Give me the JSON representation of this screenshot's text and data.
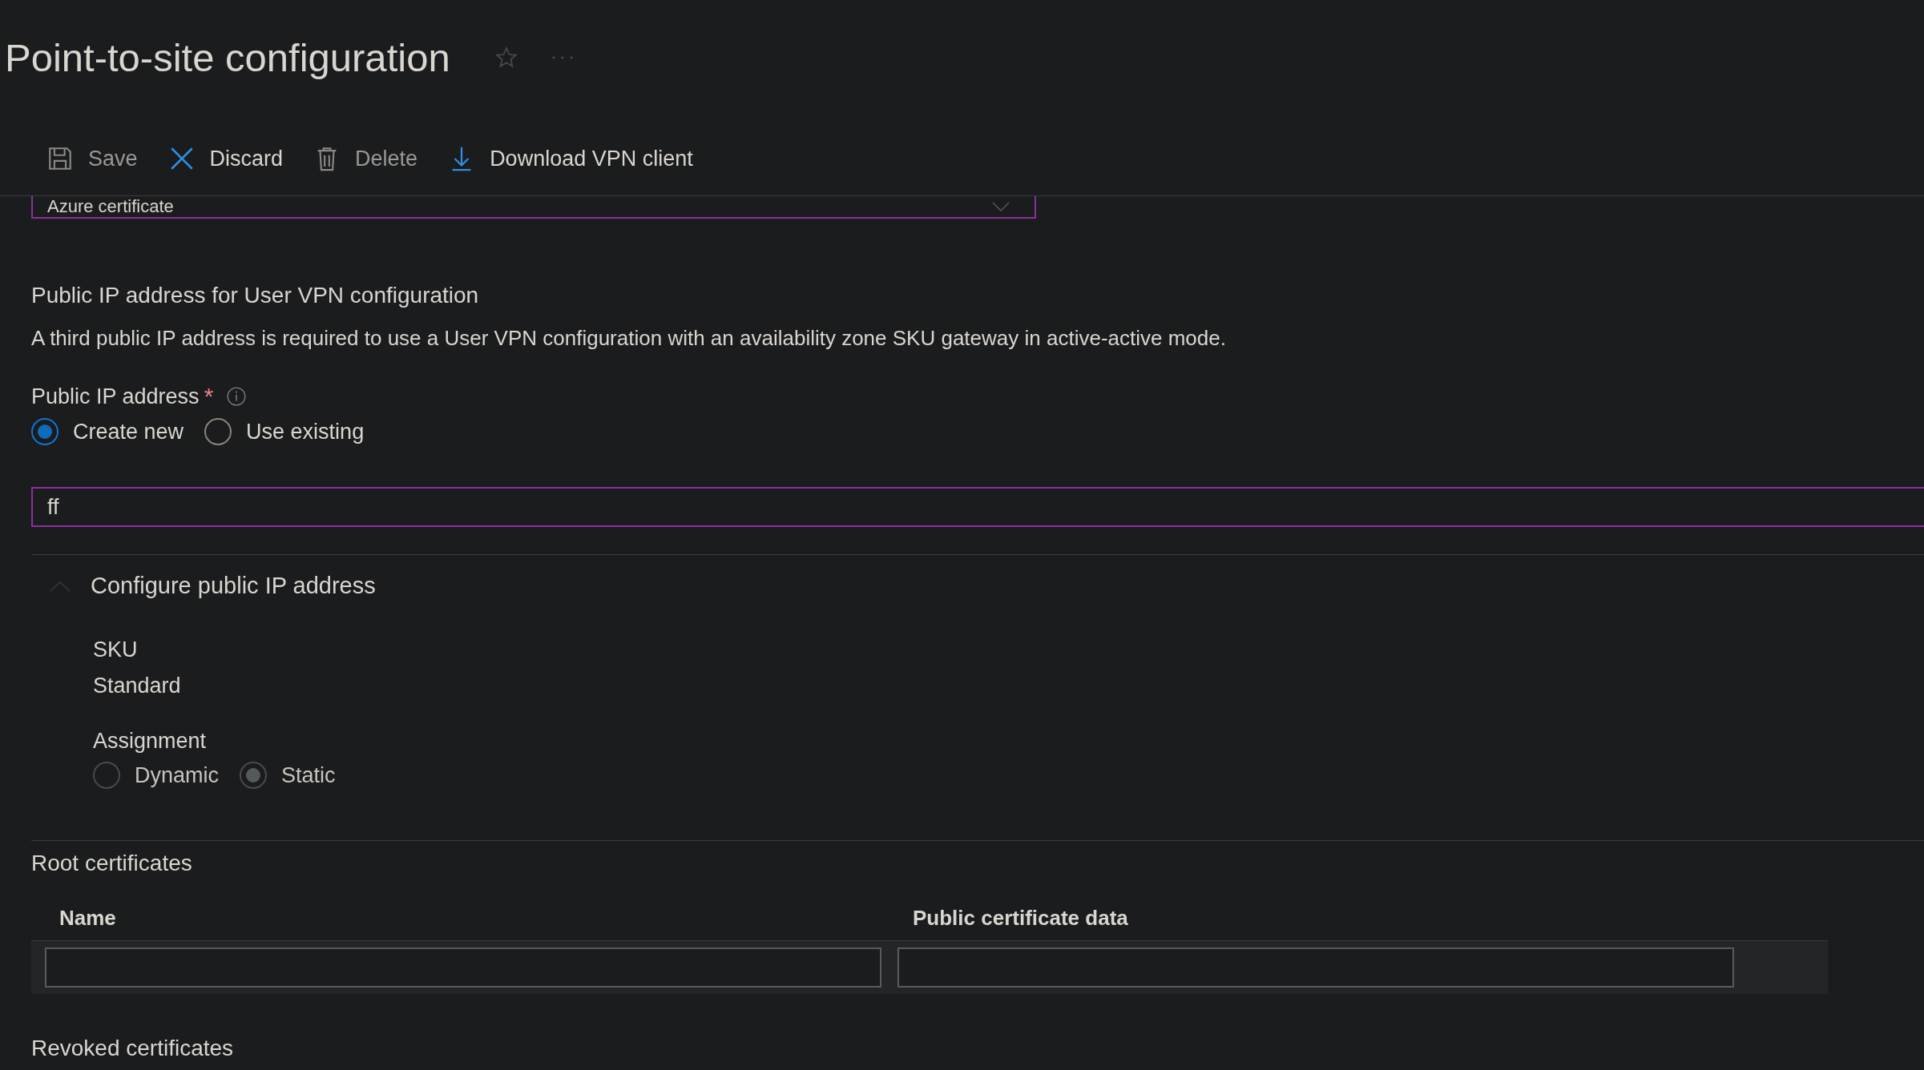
{
  "page": {
    "title": "Point-to-site configuration"
  },
  "toolbar": [
    {
      "label": "Save",
      "kind": "save",
      "disabled": true
    },
    {
      "label": "Discard",
      "kind": "discard",
      "disabled": false
    },
    {
      "label": "Delete",
      "kind": "delete",
      "disabled": true
    },
    {
      "label": "Download VPN client",
      "kind": "download",
      "disabled": false
    }
  ],
  "auth_dropdown": {
    "value": "Azure certificate"
  },
  "public_ip": {
    "heading": "Public IP address for User VPN configuration",
    "description": "A third public IP address is required to use a User VPN configuration with an availability zone SKU gateway in active-active mode.",
    "field_label": "Public IP address",
    "required_mark": "*",
    "options": [
      {
        "label": "Create new",
        "selected": true
      },
      {
        "label": "Use existing",
        "selected": false
      }
    ],
    "name_field": {
      "value": "ff"
    }
  },
  "configure": {
    "title": "Configure public IP address",
    "expanded": true,
    "sku_label": "SKU",
    "sku_value": "Standard",
    "assignment_label": "Assignment",
    "assignment_options": [
      {
        "label": "Dynamic",
        "selected": false,
        "disabled": true
      },
      {
        "label": "Static",
        "selected": true,
        "disabled": true
      }
    ]
  },
  "root_certificates": {
    "title": "Root certificates",
    "columns": [
      "Name",
      "Public certificate data"
    ]
  },
  "revoked_certificates": {
    "title": "Revoked certificates"
  }
}
